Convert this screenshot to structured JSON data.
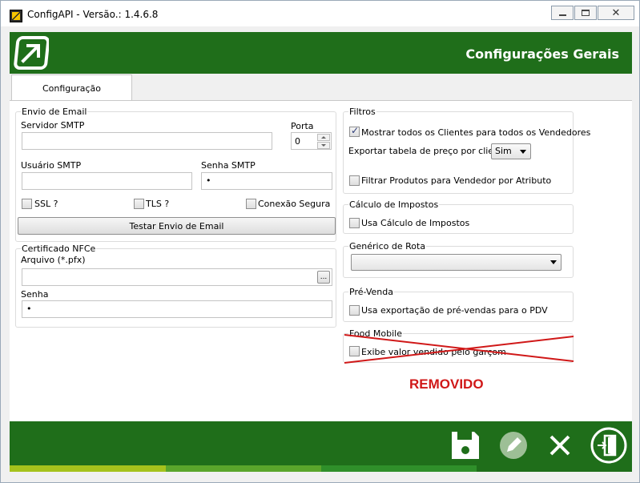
{
  "window": {
    "title": "ConfigAPI - Versão.: 1.4.6.8"
  },
  "header": {
    "title": "Configurações Gerais",
    "logo_icon": "arrow-box-logo-icon",
    "bg_color": "#1f6e1a"
  },
  "tabs": [
    {
      "label": "Configuração",
      "active": true
    }
  ],
  "email": {
    "group_title": "Envio de Email",
    "smtp_label": "Servidor SMTP",
    "smtp_value": "",
    "port_label": "Porta",
    "port_value": "0",
    "user_label": "Usuário SMTP",
    "user_value": "",
    "password_label": "Senha SMTP",
    "password_value": "•",
    "ssl_label": "SSL ?",
    "tls_label": "TLS ?",
    "secure_label": "Conexão Segura",
    "test_button": "Testar Envio de Email"
  },
  "nfce": {
    "group_title": "Certificado NFCe",
    "file_label": "Arquivo (*.pfx)",
    "file_value": "",
    "browse_button": "...",
    "password_label": "Senha",
    "password_value": "•"
  },
  "filters": {
    "group_title": "Filtros",
    "show_all_clients_label": "Mostrar todos os Clientes para todos os Vendedores",
    "show_all_clients_checked": true,
    "export_price_label": "Exportar tabela de preço por cliente",
    "export_price_value": "Sim",
    "filter_products_label": "Filtrar Produtos para Vendedor por Atributo",
    "filter_products_checked": false
  },
  "taxes": {
    "group_title": "Cálculo de Impostos",
    "use_calc_label": "Usa Cálculo de Impostos",
    "use_calc_checked": false
  },
  "route": {
    "group_title": "Genérico de Rota",
    "value": ""
  },
  "presale": {
    "group_title": "Pré-Venda",
    "export_label": "Usa exportação de pré-vendas para o PDV",
    "export_checked": false
  },
  "food_mobile": {
    "group_title": "Food Mobile",
    "show_value_label": "Exibe valor vendido pelo garçom",
    "show_value_checked": false,
    "cross_color": "#d01818"
  },
  "annotation": {
    "removed_text": "REMOVIDO",
    "color": "#d01818"
  },
  "footer": {
    "bg_color": "#1f6e1a",
    "buttons": [
      {
        "icon": "save-icon"
      },
      {
        "icon": "edit-icon",
        "disabled": true
      },
      {
        "icon": "close-x-icon"
      },
      {
        "icon": "exit-door-icon"
      }
    ],
    "stripe_colors": [
      "#a5c21c",
      "#5aa52b",
      "#2f8f2a",
      "#1f6e1a"
    ]
  }
}
